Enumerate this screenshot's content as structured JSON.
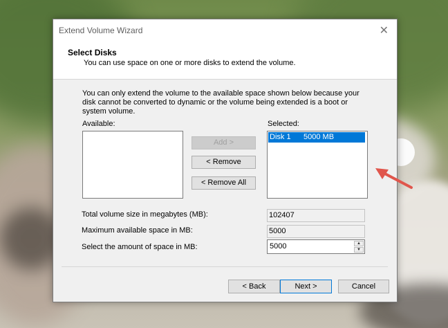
{
  "window": {
    "title": "Extend Volume Wizard",
    "close_glyph": "✕"
  },
  "header": {
    "title": "Select Disks",
    "subtitle": "You can use space on one or more disks to extend the volume."
  },
  "note": "You can only extend the volume to the available space shown below because your disk cannot be converted to dynamic or the volume being extended is a boot or system volume.",
  "available": {
    "label": "Available:",
    "items": []
  },
  "selected": {
    "label": "Selected:",
    "items": [
      {
        "disk": "Disk 1",
        "size": "5000 MB"
      }
    ]
  },
  "buttons": {
    "add": "Add >",
    "remove": "< Remove",
    "remove_all": "< Remove All",
    "back": "< Back",
    "next": "Next >",
    "cancel": "Cancel"
  },
  "fields": {
    "total_label": "Total volume size in megabytes (MB):",
    "total_value": "102407",
    "max_label": "Maximum available space in MB:",
    "max_value": "5000",
    "amount_label": "Select the amount of space in MB:",
    "amount_value": "5000"
  },
  "colors": {
    "selection": "#0078d7",
    "annotation_arrow": "#e0564c"
  }
}
